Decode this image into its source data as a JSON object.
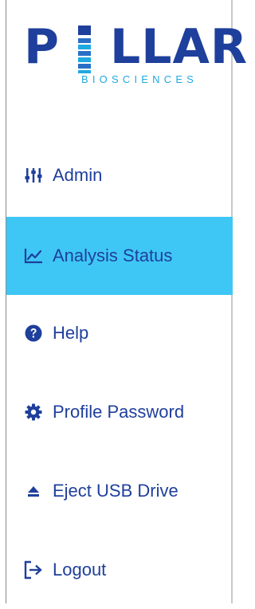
{
  "logo": {
    "word_left": "P",
    "word_right": "LLAR",
    "subtitle": "BIOSCIENCES",
    "alt": "PILLAR BIOSCIENCES"
  },
  "menu": {
    "items": [
      {
        "label": "Admin",
        "icon": "sliders-icon",
        "active": false
      },
      {
        "label": "Analysis Status",
        "icon": "line-chart-icon",
        "active": true
      },
      {
        "label": "Help",
        "icon": "question-circle-icon",
        "active": false
      },
      {
        "label": "Profile Password",
        "icon": "gear-icon",
        "active": false
      },
      {
        "label": "Eject USB Drive",
        "icon": "eject-icon",
        "active": false
      },
      {
        "label": "Logout",
        "icon": "logout-icon",
        "active": false
      }
    ]
  },
  "colors": {
    "brand_navy": "#1f3f9c",
    "brand_cyan": "#1fa9e0",
    "active_bg": "#3ec7f5",
    "text": "#1f3f9c"
  }
}
